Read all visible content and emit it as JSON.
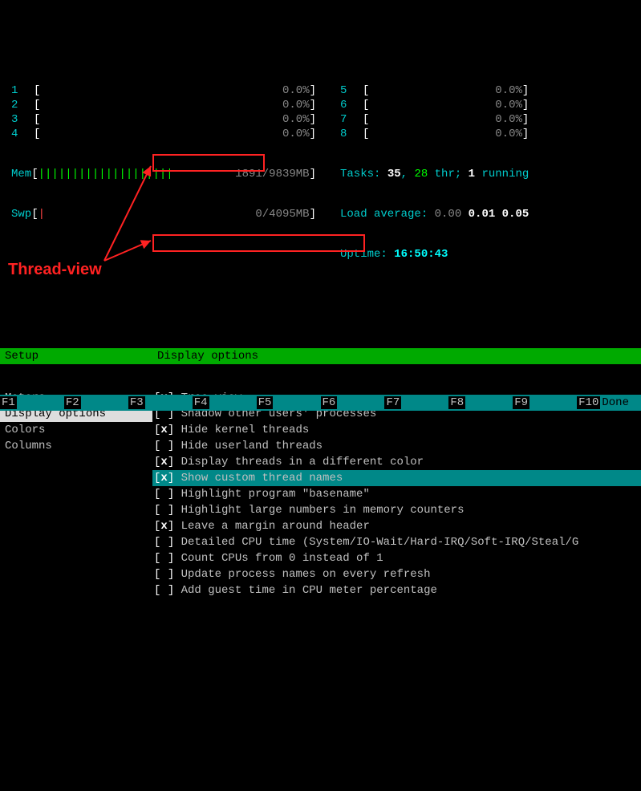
{
  "cpus_left": [
    {
      "n": "1",
      "pct": "0.0%"
    },
    {
      "n": "2",
      "pct": "0.0%"
    },
    {
      "n": "3",
      "pct": "0.0%"
    },
    {
      "n": "4",
      "pct": "0.0%"
    }
  ],
  "cpus_right": [
    {
      "n": "5",
      "pct": "0.0%"
    },
    {
      "n": "6",
      "pct": "0.0%"
    },
    {
      "n": "7",
      "pct": "0.0%"
    },
    {
      "n": "8",
      "pct": "0.0%"
    }
  ],
  "mem": {
    "label": "Mem",
    "bar": "||||||||||||||||||||",
    "used": "1891/9839MB"
  },
  "swp": {
    "label": "Swp",
    "bar": "|",
    "used": "0/4095MB"
  },
  "info": {
    "tasks_label": "Tasks: ",
    "tasks": "35",
    "tasks_sep": ", ",
    "thr": "28",
    "thr_label": " thr; ",
    "running": "1",
    "running_label": " running",
    "load_label": "Load average: ",
    "load1": "0.00",
    "load2": "0.01",
    "load3": "0.05",
    "uptime_label": "Uptime: ",
    "uptime": "16:50:43"
  },
  "setup": {
    "menu_header": "Setup",
    "panel_header": "Display options",
    "menu": [
      "Meters",
      "Display options",
      "Colors",
      "Columns"
    ],
    "selected_menu": 1,
    "options": [
      {
        "checked": true,
        "label": "Tree view"
      },
      {
        "checked": false,
        "label": "Shadow other users' processes"
      },
      {
        "checked": true,
        "label": "Hide kernel threads"
      },
      {
        "checked": false,
        "label": "Hide userland threads"
      },
      {
        "checked": true,
        "label": "Display threads in a different color"
      },
      {
        "checked": true,
        "label": "Show custom thread names",
        "selected": true
      },
      {
        "checked": false,
        "label": "Highlight program \"basename\""
      },
      {
        "checked": false,
        "label": "Highlight large numbers in memory counters"
      },
      {
        "checked": true,
        "label": "Leave a margin around header"
      },
      {
        "checked": false,
        "label": "Detailed CPU time (System/IO-Wait/Hard-IRQ/Soft-IRQ/Steal/G"
      },
      {
        "checked": false,
        "label": "Count CPUs from 0 instead of 1"
      },
      {
        "checked": false,
        "label": "Update process names on every refresh"
      },
      {
        "checked": false,
        "label": "Add guest time in CPU meter percentage"
      }
    ]
  },
  "annotation": {
    "text": "Thread-view"
  },
  "fkeys": [
    {
      "n": "F1",
      "label": ""
    },
    {
      "n": "F2",
      "label": ""
    },
    {
      "n": "F3",
      "label": ""
    },
    {
      "n": "F4",
      "label": ""
    },
    {
      "n": "F5",
      "label": ""
    },
    {
      "n": "F6",
      "label": ""
    },
    {
      "n": "F7",
      "label": ""
    },
    {
      "n": "F8",
      "label": ""
    },
    {
      "n": "F9",
      "label": ""
    },
    {
      "n": "F10",
      "label": "Done"
    }
  ]
}
